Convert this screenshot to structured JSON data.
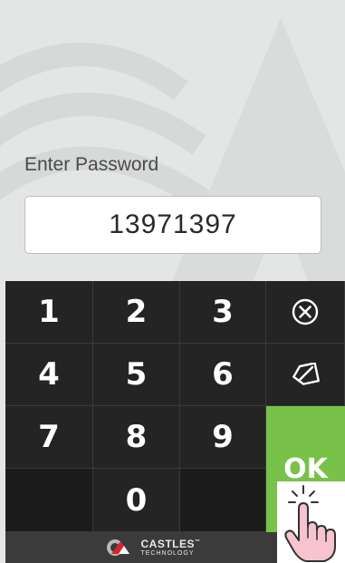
{
  "prompt": {
    "label": "Enter Password"
  },
  "password": {
    "value": "13971397"
  },
  "keypad": {
    "keys": [
      "1",
      "2",
      "3",
      "4",
      "5",
      "6",
      "7",
      "8",
      "9",
      "0"
    ],
    "ok_label": "OK",
    "clear_icon": "clear-x-circle-icon",
    "backspace_icon": "backspace-icon"
  },
  "footer": {
    "brand_name": "CASTLES",
    "brand_tm": "™",
    "brand_sub": "TECHNOLOGY"
  },
  "colors": {
    "ok_green": "#78c24a",
    "keypad_dark": "#242424",
    "background": "#e4e6e5"
  },
  "overlay": {
    "icon": "tap-hand-icon"
  }
}
